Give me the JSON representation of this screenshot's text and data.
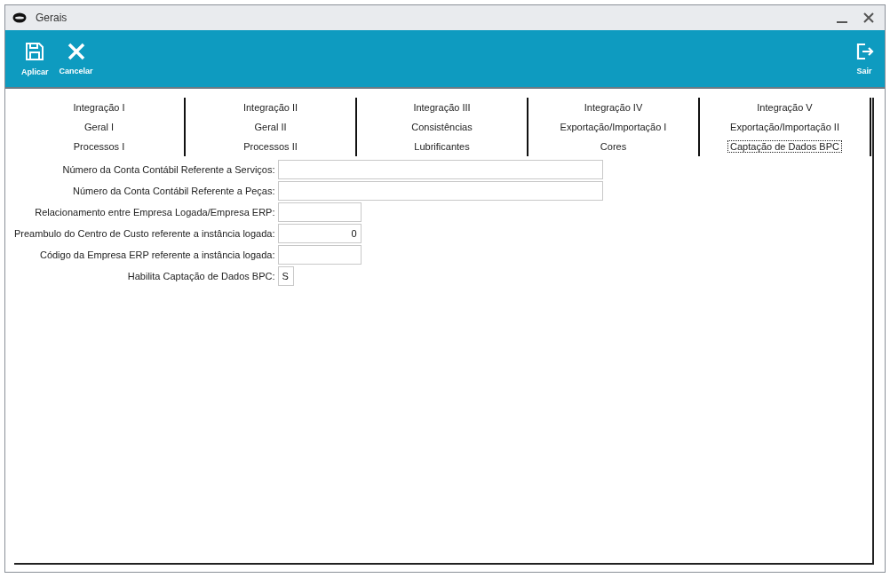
{
  "window": {
    "title": "Gerais"
  },
  "toolbar": {
    "left": [
      {
        "kind": "save",
        "label": "Aplicar"
      },
      {
        "kind": "cancel",
        "label": "Cancelar"
      }
    ],
    "right": [
      {
        "kind": "exit",
        "label": "Sair"
      }
    ]
  },
  "tabs": [
    [
      {
        "label": "Integração I",
        "selected": false
      },
      {
        "label": "Integração II",
        "selected": false
      },
      {
        "label": "Integração III",
        "selected": false
      },
      {
        "label": "Integração IV",
        "selected": false
      },
      {
        "label": "Integração V",
        "selected": false
      }
    ],
    [
      {
        "label": "Geral I",
        "selected": false
      },
      {
        "label": "Geral II",
        "selected": false
      },
      {
        "label": "Consistências",
        "selected": false
      },
      {
        "label": "Exportação/Importação I",
        "selected": false
      },
      {
        "label": "Exportação/Importação II",
        "selected": false
      }
    ],
    [
      {
        "label": "Processos I",
        "selected": false
      },
      {
        "label": "Processos II",
        "selected": false
      },
      {
        "label": "Lubrificantes",
        "selected": false
      },
      {
        "label": "Cores",
        "selected": false
      },
      {
        "label": "Captação de Dados BPC",
        "selected": true
      }
    ]
  ],
  "fields": [
    {
      "label": "Número da Conta Contábil Referente a Serviços:",
      "kind": "wide"
    },
    {
      "label": "Número da Conta Contábil Referente a Peças:",
      "kind": "wide"
    },
    {
      "label": "Relacionamento entre Empresa Logada/Empresa ERP:",
      "kind": "text"
    },
    {
      "label": "Preambulo do Centro de Custo referente a instância logada:",
      "kind": "number",
      "value": "0"
    },
    {
      "label": "Código da Empresa ERP referente a instância logada:",
      "kind": "text"
    },
    {
      "label": "Habilita Captação de Dados BPC:",
      "kind": "flag",
      "value": "S"
    }
  ]
}
